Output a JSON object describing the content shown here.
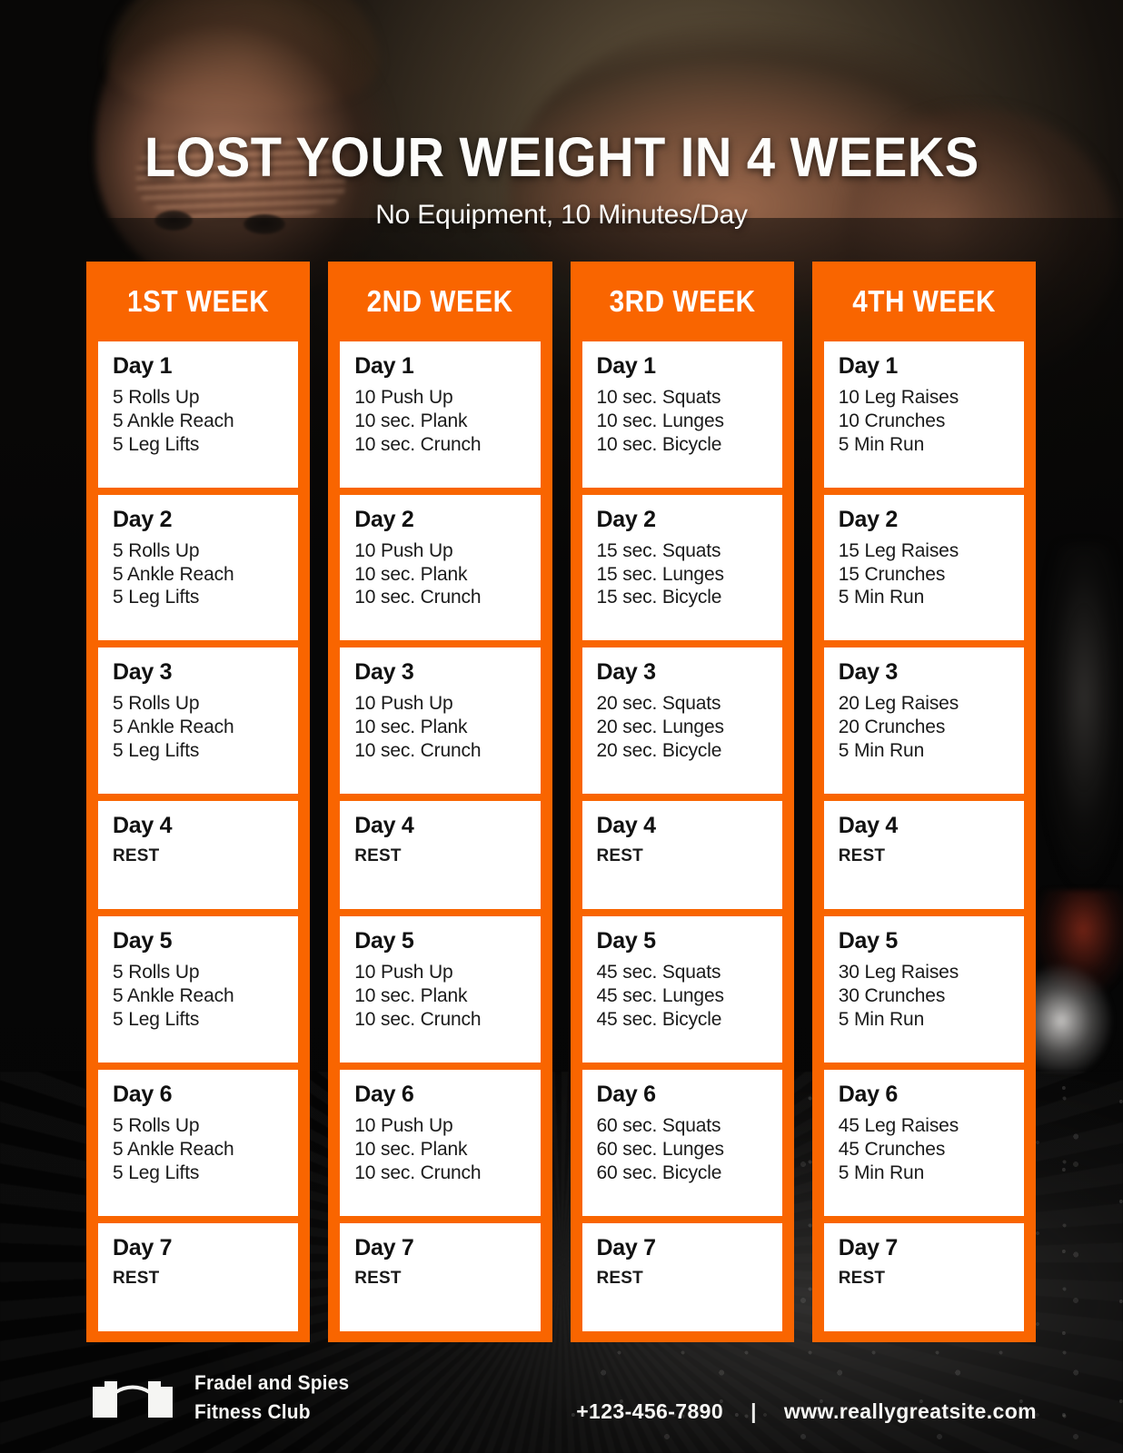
{
  "header": {
    "title": "LOST YOUR WEIGHT IN 4 WEEKS",
    "subtitle": "No Equipment, 10 Minutes/Day"
  },
  "theme": {
    "accent_orange": "#F96500",
    "card_white": "#FFFFFF",
    "text_dark": "#111111",
    "background_dark": "#0B0908"
  },
  "plan": {
    "weeks": [
      {
        "header": "1ST WEEK",
        "days": [
          {
            "title": "Day 1",
            "rest": false,
            "lines": [
              "5 Rolls Up",
              "5 Ankle Reach",
              "5 Leg Lifts"
            ]
          },
          {
            "title": "Day 2",
            "rest": false,
            "lines": [
              "5 Rolls Up",
              "5 Ankle Reach",
              "5 Leg Lifts"
            ]
          },
          {
            "title": "Day 3",
            "rest": false,
            "lines": [
              "5 Rolls Up",
              "5 Ankle Reach",
              "5 Leg Lifts"
            ]
          },
          {
            "title": "Day 4",
            "rest": true,
            "lines": [
              "REST"
            ]
          },
          {
            "title": "Day 5",
            "rest": false,
            "lines": [
              "5 Rolls Up",
              "5 Ankle Reach",
              "5 Leg Lifts"
            ]
          },
          {
            "title": "Day 6",
            "rest": false,
            "lines": [
              "5 Rolls Up",
              "5 Ankle Reach",
              "5 Leg Lifts"
            ]
          },
          {
            "title": "Day 7",
            "rest": true,
            "lines": [
              "REST"
            ]
          }
        ]
      },
      {
        "header": "2ND WEEK",
        "days": [
          {
            "title": "Day 1",
            "rest": false,
            "lines": [
              "10 Push Up",
              "10 sec. Plank",
              "10 sec. Crunch"
            ]
          },
          {
            "title": "Day 2",
            "rest": false,
            "lines": [
              "10 Push Up",
              "10 sec. Plank",
              "10 sec. Crunch"
            ]
          },
          {
            "title": "Day 3",
            "rest": false,
            "lines": [
              "10 Push Up",
              "10 sec. Plank",
              "10 sec. Crunch"
            ]
          },
          {
            "title": "Day 4",
            "rest": true,
            "lines": [
              "REST"
            ]
          },
          {
            "title": "Day 5",
            "rest": false,
            "lines": [
              "10 Push Up",
              "10 sec. Plank",
              "10 sec. Crunch"
            ]
          },
          {
            "title": "Day 6",
            "rest": false,
            "lines": [
              "10 Push Up",
              "10 sec. Plank",
              "10 sec. Crunch"
            ]
          },
          {
            "title": "Day 7",
            "rest": true,
            "lines": [
              "REST"
            ]
          }
        ]
      },
      {
        "header": "3RD WEEK",
        "days": [
          {
            "title": "Day 1",
            "rest": false,
            "lines": [
              "10 sec. Squats",
              "10 sec. Lunges",
              "10 sec. Bicycle"
            ]
          },
          {
            "title": "Day 2",
            "rest": false,
            "lines": [
              "15 sec. Squats",
              "15 sec. Lunges",
              "15 sec. Bicycle"
            ]
          },
          {
            "title": "Day 3",
            "rest": false,
            "lines": [
              "20 sec. Squats",
              "20 sec. Lunges",
              "20 sec. Bicycle"
            ]
          },
          {
            "title": "Day 4",
            "rest": true,
            "lines": [
              "REST"
            ]
          },
          {
            "title": "Day 5",
            "rest": false,
            "lines": [
              "45 sec. Squats",
              "45 sec. Lunges",
              "45 sec. Bicycle"
            ]
          },
          {
            "title": "Day 6",
            "rest": false,
            "lines": [
              "60 sec. Squats",
              "60 sec. Lunges",
              "60 sec. Bicycle"
            ]
          },
          {
            "title": "Day 7",
            "rest": true,
            "lines": [
              "REST"
            ]
          }
        ]
      },
      {
        "header": "4TH WEEK",
        "days": [
          {
            "title": "Day 1",
            "rest": false,
            "lines": [
              "10 Leg Raises",
              "10 Crunches",
              "5 Min Run"
            ]
          },
          {
            "title": "Day 2",
            "rest": false,
            "lines": [
              "15 Leg Raises",
              "15 Crunches",
              "5 Min Run"
            ]
          },
          {
            "title": "Day 3",
            "rest": false,
            "lines": [
              "20 Leg Raises",
              "20 Crunches",
              "5 Min Run"
            ]
          },
          {
            "title": "Day 4",
            "rest": true,
            "lines": [
              "REST"
            ]
          },
          {
            "title": "Day 5",
            "rest": false,
            "lines": [
              "30 Leg Raises",
              "30 Crunches",
              "5 Min Run"
            ]
          },
          {
            "title": "Day 6",
            "rest": false,
            "lines": [
              "45 Leg Raises",
              "45 Crunches",
              "5 Min Run"
            ]
          },
          {
            "title": "Day 7",
            "rest": true,
            "lines": [
              "REST"
            ]
          }
        ]
      }
    ]
  },
  "footer": {
    "brand_icon": "barbell-icon",
    "brand_line_1": "Fradel and Spies",
    "brand_line_2": "Fitness Club",
    "phone": "+123-456-7890",
    "separator": "|",
    "website": "www.reallygreatsite.com"
  }
}
